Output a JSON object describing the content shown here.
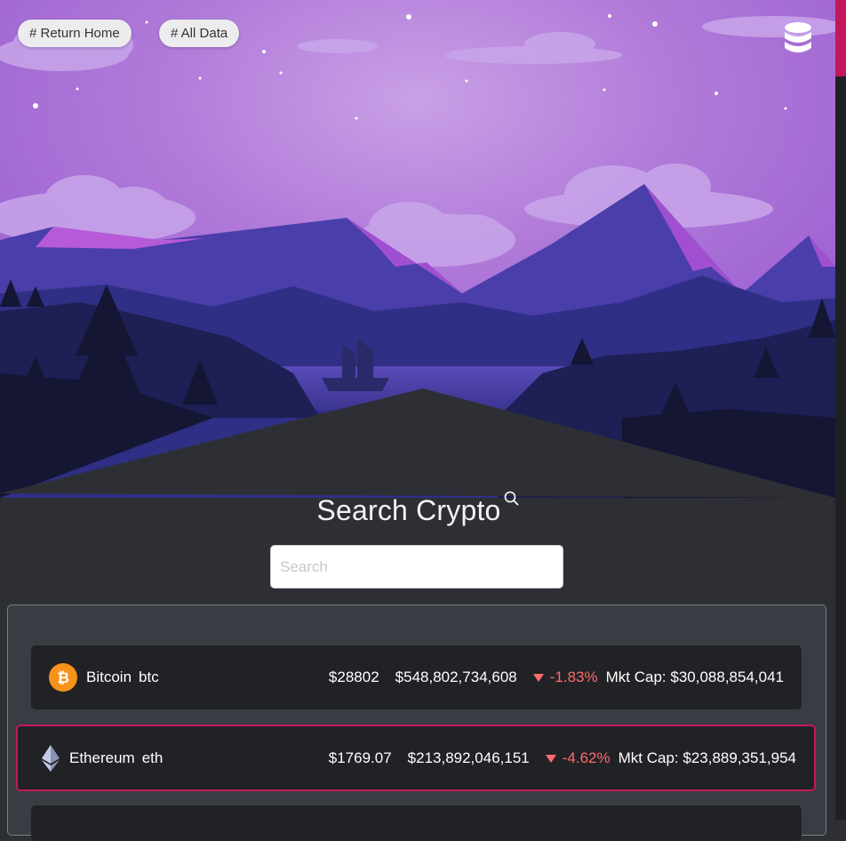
{
  "nav": {
    "return_home": "# Return Home",
    "all_data": "# All Data"
  },
  "icons": {
    "database": "database-icon",
    "search": "magnifier-icon",
    "down": "triangle-down-icon"
  },
  "colors": {
    "accent": "#c2185b",
    "negative": "#ff6b6b",
    "bitcoin": "#f7931a"
  },
  "search": {
    "title": "Search Crypto",
    "placeholder": "Search",
    "value": ""
  },
  "coins": [
    {
      "name": "Bitcoin",
      "symbol": "btc",
      "price": "$28802",
      "volume": "$548,802,734,608",
      "change": "-1.83%",
      "market_cap": "Mkt Cap: $30,088,854,041",
      "icon": "bitcoin-icon"
    },
    {
      "name": "Ethereum",
      "symbol": "eth",
      "price": "$1769.07",
      "volume": "$213,892,046,151",
      "change": "-4.62%",
      "market_cap": "Mkt Cap: $23,889,351,954",
      "icon": "ethereum-icon"
    }
  ]
}
